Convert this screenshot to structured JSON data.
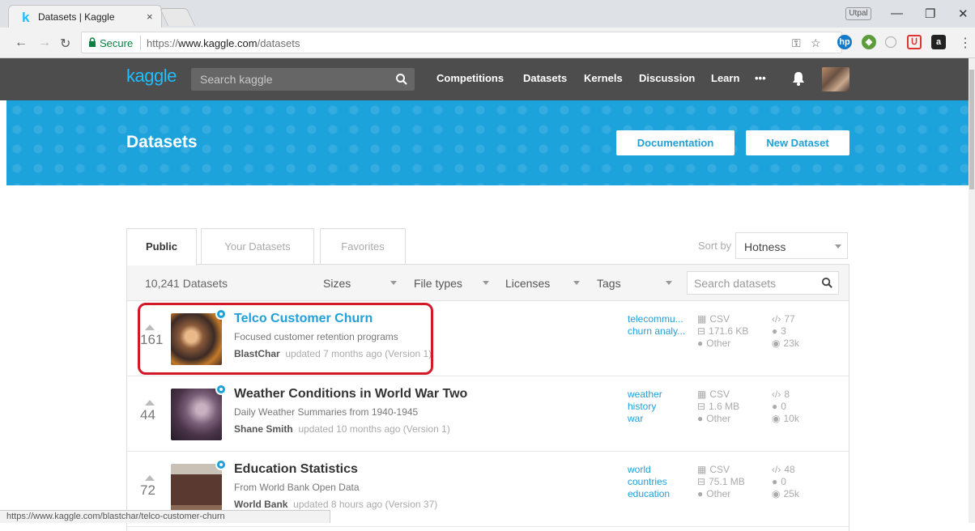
{
  "browser": {
    "tab_title": "Datasets | Kaggle",
    "tab_favicon": "k",
    "tab_close": "×",
    "profile_label": "Utpal",
    "secure_label": "Secure",
    "url_scheme": "https://",
    "url_host": "www.kaggle.com",
    "url_path": "/datasets",
    "status_url": "https://www.kaggle.com/blastchar/telco-customer-churn",
    "icons": [
      "back-icon",
      "forward-icon",
      "reload-icon",
      "lock-icon",
      "key-icon",
      "star-icon",
      "hp-icon",
      "puzzle-icon",
      "circle-icon",
      "pocket-icon",
      "amazon-icon",
      "menu-icon"
    ]
  },
  "kaggle_nav": {
    "logo": "kaggle",
    "search_placeholder": "Search kaggle",
    "links": [
      "Competitions",
      "Datasets",
      "Kernels",
      "Discussion",
      "Learn",
      "•••"
    ]
  },
  "hero": {
    "title": "Datasets",
    "documentation_button": "Documentation",
    "new_dataset_button": "New Dataset"
  },
  "panel": {
    "tabs": [
      "Public",
      "Your Datasets",
      "Favorites"
    ],
    "sort_label": "Sort by",
    "sort_value": "Hotness",
    "count": "10,241 Datasets",
    "filters": [
      "Sizes",
      "File types",
      "Licenses",
      "Tags"
    ],
    "search_placeholder": "Search datasets"
  },
  "datasets": [
    {
      "votes": "161",
      "title": "Telco Customer Churn",
      "subtitle": "Focused customer retention programs",
      "author": "BlastChar",
      "updated": "updated 7 months ago (Version 1)",
      "tags": [
        "telecommu...",
        "churn analy..."
      ],
      "file_type": "CSV",
      "size": "171.6 KB",
      "license": "Other",
      "kernels": "77",
      "comments": "3",
      "views": "23k"
    },
    {
      "votes": "44",
      "title": "Weather Conditions in World War Two",
      "subtitle": "Daily Weather Summaries from 1940-1945",
      "author": "Shane Smith",
      "updated": "updated 10 months ago (Version 1)",
      "tags": [
        "weather",
        "history",
        "war"
      ],
      "file_type": "CSV",
      "size": "1.6 MB",
      "license": "Other",
      "kernels": "8",
      "comments": "0",
      "views": "10k"
    },
    {
      "votes": "72",
      "title": "Education Statistics",
      "subtitle": "From World Bank Open Data",
      "author": "World Bank",
      "updated": "updated 8 hours ago (Version 37)",
      "tags": [
        "world",
        "countries",
        "education"
      ],
      "file_type": "CSV",
      "size": "75.1 MB",
      "license": "Other",
      "kernels": "48",
      "comments": "0",
      "views": "25k"
    }
  ],
  "colors": {
    "kaggle_blue": "#20beff",
    "hero_blue": "#1da3dc",
    "nav_dark": "#4d4d4d",
    "highlight_red": "#d3182a"
  }
}
